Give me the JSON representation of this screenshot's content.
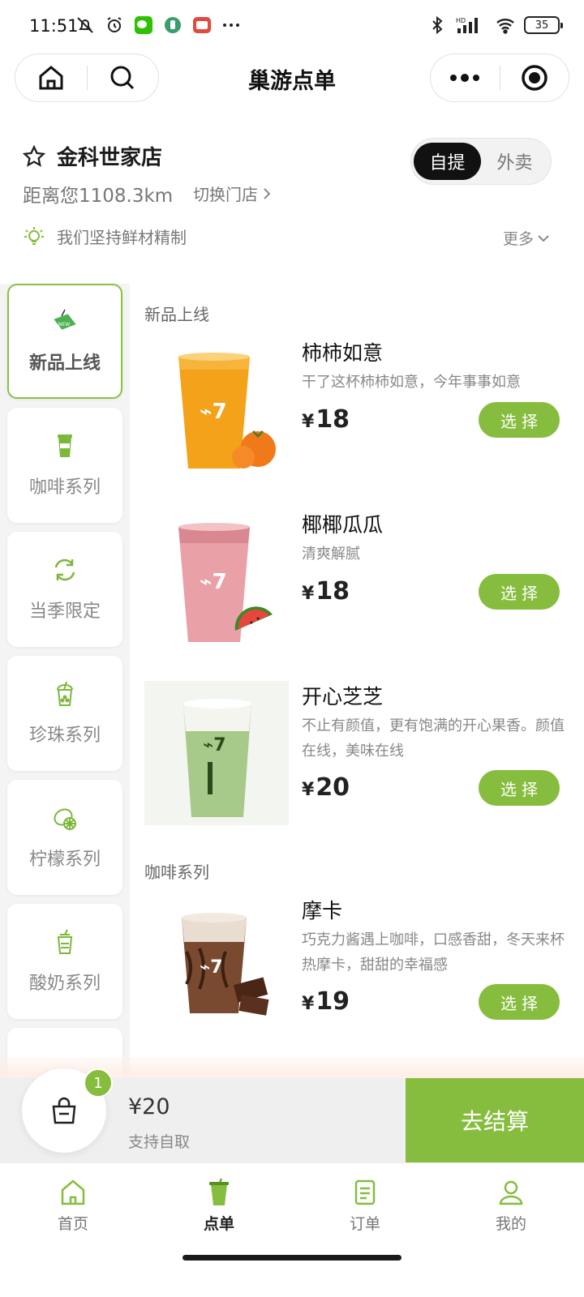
{
  "status": {
    "time": "11:51",
    "battery": "35",
    "network": "HD"
  },
  "nav": {
    "title": "巢游点单"
  },
  "store": {
    "name": "金科世家店",
    "distance": "距离您1108.3km",
    "switch_label": "切换门店",
    "mode_options": [
      "自提",
      "外卖"
    ],
    "mode_selected": "自提",
    "notice": "我们坚持鲜材精制",
    "more_label": "更多"
  },
  "categories": [
    {
      "label": "新品上线",
      "icon": "new-tag-icon",
      "active": true
    },
    {
      "label": "咖啡系列",
      "icon": "coffee-cup-icon",
      "active": false
    },
    {
      "label": "当季限定",
      "icon": "refresh-cycle-icon",
      "active": false
    },
    {
      "label": "珍珠系列",
      "icon": "bubble-tea-icon",
      "active": false
    },
    {
      "label": "柠檬系列",
      "icon": "lemon-icon",
      "active": false
    },
    {
      "label": "酸奶系列",
      "icon": "yogurt-cup-icon",
      "active": false
    }
  ],
  "sections": [
    {
      "title": "新品上线"
    },
    {
      "title": "咖啡系列"
    }
  ],
  "products": [
    {
      "name": "柿柿如意",
      "desc": "干了这杯柿柿如意，今年事事如意",
      "currency": "¥",
      "price": "18",
      "button": "选择",
      "drink_color": "#f4a21a",
      "fruit": "persimmon"
    },
    {
      "name": "椰椰瓜瓜",
      "desc": "清爽解腻",
      "currency": "¥",
      "price": "18",
      "button": "选择",
      "drink_color": "#e8a3a8",
      "fruit": "watermelon"
    },
    {
      "name": "开心芝芝",
      "desc": "不止有颜值，更有饱满的开心果香。颜值在线，美味在线",
      "currency": "¥",
      "price": "20",
      "button": "选择",
      "drink_color": "#a9c98a",
      "fruit": "none"
    },
    {
      "name": "摩卡",
      "desc": "巧克力酱遇上咖啡，口感香甜，冬天来杯热摩卡，甜甜的幸福感",
      "currency": "¥",
      "price": "19",
      "button": "选择",
      "drink_color": "#6b4330",
      "fruit": "chocolate"
    }
  ],
  "cart": {
    "count": "1",
    "total": "¥20",
    "sub": "支持自取",
    "checkout": "去结算"
  },
  "tabs": [
    {
      "label": "首页",
      "icon": "home-icon",
      "active": false
    },
    {
      "label": "点单",
      "icon": "drink-cup-icon",
      "active": true
    },
    {
      "label": "订单",
      "icon": "order-list-icon",
      "active": false
    },
    {
      "label": "我的",
      "icon": "user-icon",
      "active": false
    }
  ],
  "colors": {
    "accent": "#86bd3e",
    "dark": "#111111",
    "muted": "#888888"
  }
}
